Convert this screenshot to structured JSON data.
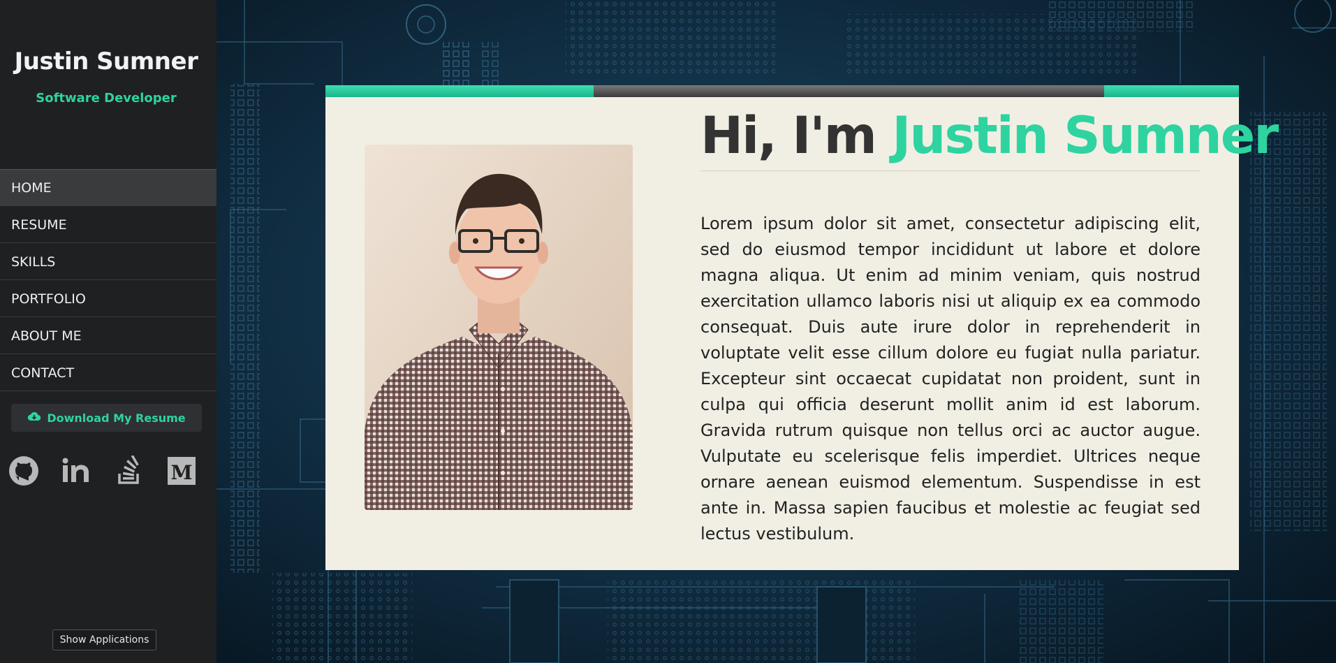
{
  "sidebar": {
    "name": "Justin Sumner",
    "role": "Software Developer",
    "nav": [
      {
        "label": "HOME",
        "active": true
      },
      {
        "label": "RESUME",
        "active": false
      },
      {
        "label": "SKILLS",
        "active": false
      },
      {
        "label": "PORTFOLIO",
        "active": false
      },
      {
        "label": "ABOUT ME",
        "active": false
      },
      {
        "label": "CONTACT",
        "active": false
      }
    ],
    "download_label": "Download My Resume",
    "socials": [
      "github-icon",
      "linkedin-icon",
      "stackoverflow-icon",
      "medium-icon"
    ]
  },
  "main": {
    "greeting": "Hi, I'm ",
    "name": "Justin Sumner",
    "bio": "Lorem ipsum dolor sit amet, consectetur adipiscing elit, sed do eiusmod tempor incididunt ut labore et dolore magna aliqua. Ut enim ad minim veniam, quis nostrud exercitation ullamco laboris nisi ut aliquip ex ea commodo consequat. Duis aute irure dolor in reprehenderit in voluptate velit esse cillum dolore eu fugiat nulla pariatur. Excepteur sint occaecat cupidatat non proident, sunt in culpa qui officia deserunt mollit anim id est laborum. Gravida rutrum quisque non tellus orci ac auctor augue. Vulputate eu scelerisque felis imperdiet. Ultrices neque ornare aenean euismod elementum. Suspendisse in est ante in. Massa sapien faucibus et molestie ac feugiat sed lectus vestibulum."
  },
  "taskbar": {
    "show_apps_label": "Show Applications"
  },
  "colors": {
    "accent": "#2ed3a0",
    "sidebar_bg": "#1f2022",
    "card_bg": "#f1efe4"
  }
}
